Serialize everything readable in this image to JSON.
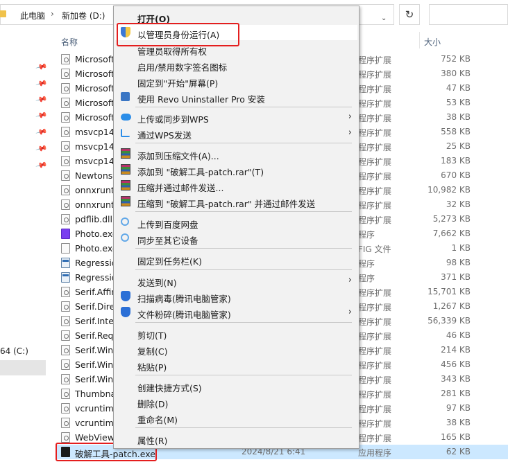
{
  "address": {
    "crumbs": [
      "此电脑",
      "新加卷 (D:)"
    ],
    "separator": "›",
    "refresh_icon": "↻",
    "dropdown_icon": "⌄"
  },
  "left_pane": {
    "drive_label": "64 (C:)"
  },
  "columns": {
    "name": "名称",
    "size": "大小"
  },
  "files": [
    {
      "name": "Microsoft",
      "date": "",
      "type": "程序扩展",
      "size": "752 KB",
      "icon": "gear"
    },
    {
      "name": "Microsoft",
      "date": "",
      "type": "程序扩展",
      "size": "380 KB",
      "icon": "gear"
    },
    {
      "name": "Microsoft",
      "date": "",
      "type": "程序扩展",
      "size": "47 KB",
      "icon": "gear"
    },
    {
      "name": "Microsoft",
      "date": "",
      "type": "程序扩展",
      "size": "53 KB",
      "icon": "gear"
    },
    {
      "name": "Microsoft",
      "date": "",
      "type": "程序扩展",
      "size": "38 KB",
      "icon": "gear"
    },
    {
      "name": "msvcp140",
      "date": "",
      "type": "程序扩展",
      "size": "558 KB",
      "icon": "gear"
    },
    {
      "name": "msvcp140",
      "date": "",
      "type": "程序扩展",
      "size": "25 KB",
      "icon": "gear"
    },
    {
      "name": "msvcp140",
      "date": "",
      "type": "程序扩展",
      "size": "183 KB",
      "icon": "gear"
    },
    {
      "name": "Newtonso",
      "date": "",
      "type": "程序扩展",
      "size": "670 KB",
      "icon": "gear"
    },
    {
      "name": "onnxrunti",
      "date": "",
      "type": "程序扩展",
      "size": "10,982 KB",
      "icon": "gear"
    },
    {
      "name": "onnxrunti",
      "date": "",
      "type": "程序扩展",
      "size": "32 KB",
      "icon": "gear"
    },
    {
      "name": "pdflib.dll",
      "date": "",
      "type": "程序扩展",
      "size": "5,273 KB",
      "icon": "gear"
    },
    {
      "name": "Photo.exe",
      "date": "",
      "type": "程序",
      "size": "7,662 KB",
      "icon": "photo"
    },
    {
      "name": "Photo.exe",
      "date": "",
      "type": "FIG 文件",
      "size": "1 KB",
      "icon": "file"
    },
    {
      "name": "Regressio",
      "date": "",
      "type": "程序",
      "size": "98 KB",
      "icon": "win"
    },
    {
      "name": "Regressio",
      "date": "",
      "type": "程序",
      "size": "371 KB",
      "icon": "win"
    },
    {
      "name": "Serif.Affin",
      "date": "",
      "type": "程序扩展",
      "size": "15,701 KB",
      "icon": "gear"
    },
    {
      "name": "Serif.Dire",
      "date": "",
      "type": "程序扩展",
      "size": "1,267 KB",
      "icon": "gear"
    },
    {
      "name": "Serif.Inter",
      "date": "",
      "type": "程序扩展",
      "size": "56,339 KB",
      "icon": "gear"
    },
    {
      "name": "Serif.Requ",
      "date": "",
      "type": "程序扩展",
      "size": "46 KB",
      "icon": "gear"
    },
    {
      "name": "Serif.Win",
      "date": "",
      "type": "程序扩展",
      "size": "214 KB",
      "icon": "gear"
    },
    {
      "name": "Serif.Winc",
      "date": "",
      "type": "程序扩展",
      "size": "456 KB",
      "icon": "gear"
    },
    {
      "name": "Serif.Winf",
      "date": "",
      "type": "程序扩展",
      "size": "343 KB",
      "icon": "gear"
    },
    {
      "name": "Thumbna",
      "date": "",
      "type": "程序扩展",
      "size": "281 KB",
      "icon": "gear"
    },
    {
      "name": "vcruntime",
      "date": "",
      "type": "程序扩展",
      "size": "97 KB",
      "icon": "gear"
    },
    {
      "name": "vcruntime",
      "date": "",
      "type": "程序扩展",
      "size": "38 KB",
      "icon": "gear"
    },
    {
      "name": "WebView",
      "date": "",
      "type": "程序扩展",
      "size": "165 KB",
      "icon": "gear"
    },
    {
      "name": "破解工具-patch.exe",
      "date": "2024/8/21 6:41",
      "type": "应用程序",
      "size": "62 KB",
      "icon": "patch"
    }
  ],
  "context_menu": {
    "items": [
      {
        "label": "打开(O)",
        "bold": true,
        "icon": ""
      },
      {
        "label": "以管理员身份运行(A)",
        "icon": "shield-icon"
      },
      {
        "label": "管理员取得所有权",
        "icon": ""
      },
      {
        "label": "启用/禁用数字签名图标",
        "icon": ""
      },
      {
        "label": "固定到\"开始\"屏幕(P)",
        "icon": ""
      },
      {
        "label": "使用 Revo Uninstaller Pro 安装",
        "icon": "revo-icon"
      },
      {
        "label": "上传或同步到WPS",
        "icon": "cloud-icon",
        "submenu": true
      },
      {
        "label": "通过WPS发送",
        "icon": "share-icon",
        "submenu": true
      },
      {
        "label": "添加到压缩文件(A)...",
        "icon": "winrar-icon"
      },
      {
        "label": "添加到 \"破解工具-patch.rar\"(T)",
        "icon": "winrar-icon"
      },
      {
        "label": "压缩并通过邮件发送...",
        "icon": "winrar-icon"
      },
      {
        "label": "压缩到 \"破解工具-patch.rar\" 并通过邮件发送",
        "icon": "winrar-icon"
      },
      {
        "label": "上传到百度网盘",
        "icon": "baidu-icon"
      },
      {
        "label": "同步至其它设备",
        "icon": "baidu-icon"
      },
      {
        "label": "固定到任务栏(K)",
        "icon": ""
      },
      {
        "label": "发送到(N)",
        "icon": "",
        "submenu": true
      },
      {
        "label": "扫描病毒(腾讯电脑管家)",
        "icon": "tencent-icon"
      },
      {
        "label": "文件粉碎(腾讯电脑管家)",
        "icon": "tencent-icon",
        "submenu": true
      },
      {
        "label": "剪切(T)",
        "icon": ""
      },
      {
        "label": "复制(C)",
        "icon": ""
      },
      {
        "label": "粘贴(P)",
        "icon": ""
      },
      {
        "label": "创建快捷方式(S)",
        "icon": ""
      },
      {
        "label": "删除(D)",
        "icon": ""
      },
      {
        "label": "重命名(M)",
        "icon": ""
      },
      {
        "label": "属性(R)",
        "icon": ""
      }
    ],
    "submenu_arrow": "›"
  },
  "highlight_color": "#e41e1e",
  "selection_color": "#cce8ff"
}
